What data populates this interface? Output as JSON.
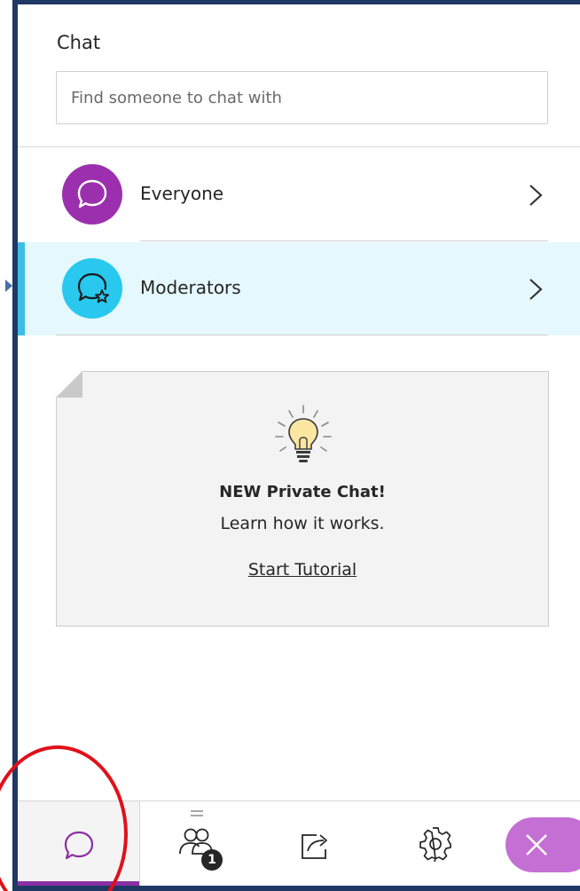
{
  "panel": {
    "title": "Chat",
    "search": {
      "placeholder": "Find someone to chat with",
      "value": ""
    }
  },
  "channels": [
    {
      "label": "Everyone",
      "icon": "chat-bubble-icon",
      "color": "#9b2fae",
      "selected": false
    },
    {
      "label": "Moderators",
      "icon": "chat-bubble-star-icon",
      "color": "#29c8ef",
      "selected": true
    }
  ],
  "tutorial": {
    "icon": "lightbulb-icon",
    "heading": "NEW Private Chat!",
    "subtext": "Learn how it works.",
    "link": "Start Tutorial"
  },
  "bottom_bar": {
    "tabs": [
      {
        "name": "chat",
        "icon": "chat-bubble-icon",
        "active": true
      },
      {
        "name": "participants",
        "icon": "participants-icon",
        "badge": "1"
      },
      {
        "name": "share-content",
        "icon": "share-icon"
      },
      {
        "name": "settings",
        "icon": "gear-icon"
      }
    ],
    "close_icon": "close-icon"
  },
  "colors": {
    "accent_purple": "#8b2fa5",
    "selected_row_bg": "#e5f8fd",
    "selected_accent": "#3dbde6",
    "frame": "#1f3864",
    "highlight_circle": "#e0101a"
  }
}
